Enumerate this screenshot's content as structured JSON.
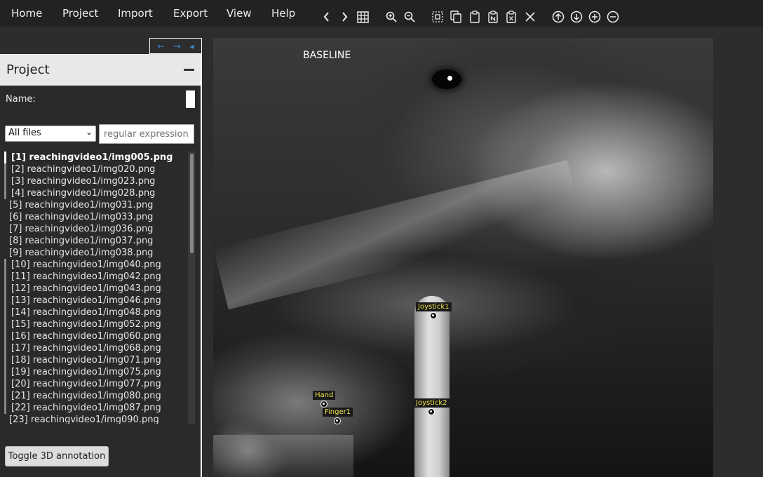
{
  "menu": {
    "home": "Home",
    "project": "Project",
    "import": "Import",
    "export": "Export",
    "view": "View",
    "help": "Help"
  },
  "toolbar": {
    "icons": [
      "chevron-left",
      "chevron-right",
      "grid",
      "zoom-in",
      "zoom-out",
      "select-region",
      "copy",
      "paste",
      "paste-n",
      "paste-delete",
      "close",
      "arrow-up",
      "arrow-down",
      "add",
      "remove"
    ]
  },
  "nav": {
    "prev": "←",
    "next": "→",
    "collapse": "◂"
  },
  "panel": {
    "title": "Project",
    "name_label": "Name:",
    "filter_selected": "All files",
    "regex_placeholder": "regular expression",
    "files": [
      {
        "label": "[1] reachingvideo1/img005.png",
        "state": "active"
      },
      {
        "label": "[2] reachingvideo1/img020.png",
        "state": "marked"
      },
      {
        "label": "[3] reachingvideo1/img023.png",
        "state": "marked"
      },
      {
        "label": "[4] reachingvideo1/img028.png",
        "state": "marked"
      },
      {
        "label": "[5] reachingvideo1/img031.png",
        "state": "unmarked"
      },
      {
        "label": "[6] reachingvideo1/img033.png",
        "state": "unmarked"
      },
      {
        "label": "[7] reachingvideo1/img036.png",
        "state": "unmarked"
      },
      {
        "label": "[8] reachingvideo1/img037.png",
        "state": "unmarked"
      },
      {
        "label": "[9] reachingvideo1/img038.png",
        "state": "unmarked"
      },
      {
        "label": "[10] reachingvideo1/img040.png",
        "state": "marked"
      },
      {
        "label": "[11] reachingvideo1/img042.png",
        "state": "marked"
      },
      {
        "label": "[12] reachingvideo1/img043.png",
        "state": "marked"
      },
      {
        "label": "[13] reachingvideo1/img046.png",
        "state": "marked"
      },
      {
        "label": "[14] reachingvideo1/img048.png",
        "state": "marked"
      },
      {
        "label": "[15] reachingvideo1/img052.png",
        "state": "marked"
      },
      {
        "label": "[16] reachingvideo1/img060.png",
        "state": "marked"
      },
      {
        "label": "[17] reachingvideo1/img068.png",
        "state": "marked"
      },
      {
        "label": "[18] reachingvideo1/img071.png",
        "state": "marked"
      },
      {
        "label": "[19] reachingvideo1/img075.png",
        "state": "marked"
      },
      {
        "label": "[20] reachingvideo1/img077.png",
        "state": "marked"
      },
      {
        "label": "[21] reachingvideo1/img080.png",
        "state": "marked"
      },
      {
        "label": "[22] reachingvideo1/img087.png",
        "state": "marked"
      },
      {
        "label": "[23] reachingvideo1/img090.png",
        "state": "unmarked"
      }
    ],
    "toggle_3d": "Toggle 3D annotation"
  },
  "canvas": {
    "baseline_label": "BASELINE",
    "keypoints": [
      {
        "name": "Joystick1"
      },
      {
        "name": "Joystick2"
      },
      {
        "name": "Hand"
      },
      {
        "name": "Finger1"
      }
    ],
    "label_color": "#f0e64a"
  }
}
